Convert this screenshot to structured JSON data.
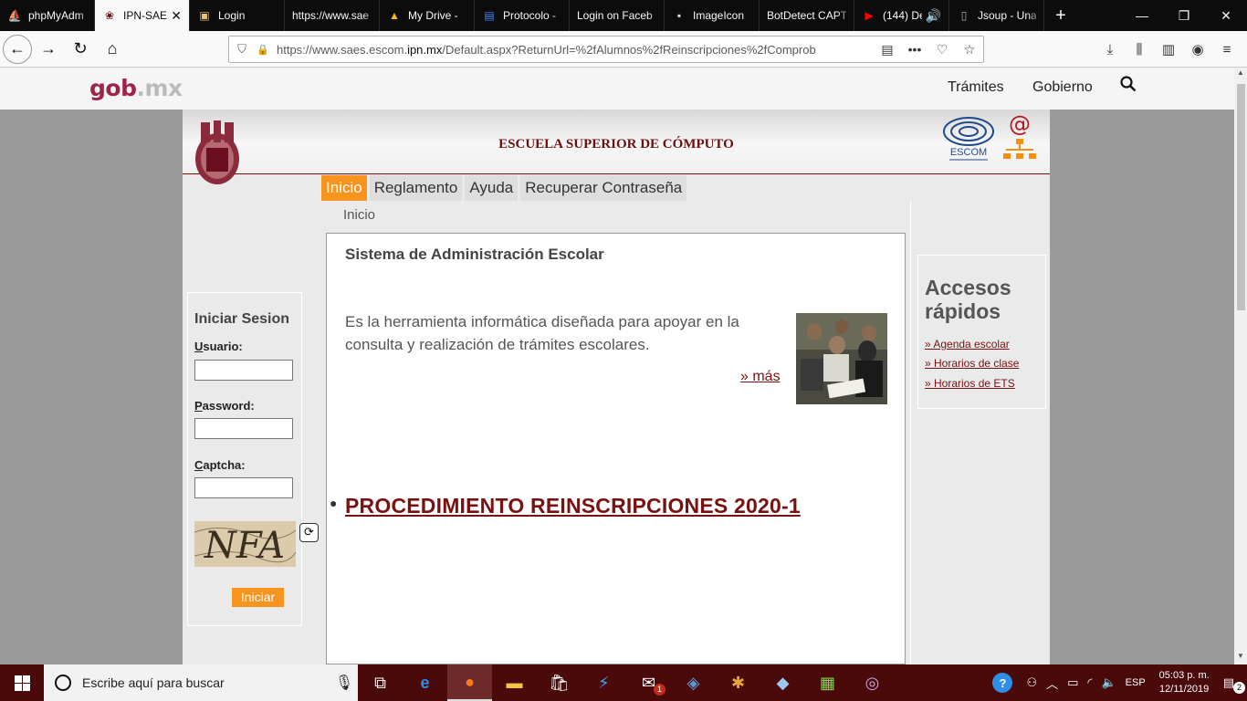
{
  "browser": {
    "tabs": [
      {
        "label": "phpMyAdm",
        "icon": "phpmyadmin-icon",
        "active": false
      },
      {
        "label": "IPN-SAE",
        "icon": "ipn-icon",
        "active": true
      },
      {
        "label": "Login",
        "icon": "image-icon",
        "active": false
      },
      {
        "label": "https://www.sae",
        "icon": "",
        "active": false
      },
      {
        "label": "My Drive - ",
        "icon": "google-drive-icon",
        "active": false
      },
      {
        "label": "Protocolo - ",
        "icon": "google-docs-icon",
        "active": false
      },
      {
        "label": "Login on Faceb",
        "icon": "",
        "active": false
      },
      {
        "label": "ImageIcon ",
        "icon": "page-icon",
        "active": false
      },
      {
        "label": "BotDetect CAPT",
        "icon": "",
        "active": false
      },
      {
        "label": "(144) De",
        "icon": "youtube-icon",
        "active": false
      },
      {
        "label": "Jsoup - Una",
        "icon": "page-icon",
        "active": false
      }
    ],
    "url_prefix": "https://www.saes.escom.",
    "url_domain": "ipn.mx",
    "url_rest": "/Default.aspx?ReturnUrl=%2fAlumnos%2fReinscripciones%2fComprob",
    "more_menu": "•••"
  },
  "gob": {
    "logo_main": "gob",
    "logo_suffix": ".mx",
    "nav_tramites": "Trámites",
    "nav_gobierno": "Gobierno"
  },
  "site": {
    "school_name": "ESCUELA SUPERIOR DE CÓMPUTO",
    "escom_label": "ESCOM",
    "menu": [
      "Inicio",
      "Reglamento",
      "Ayuda",
      "Recuperar Contraseña"
    ],
    "breadcrumb": "Inicio"
  },
  "login": {
    "title": "Iniciar Sesion",
    "usuario_key": "U",
    "usuario_rest": "suario:",
    "password_key": "P",
    "password_rest": "assword:",
    "captcha_key": "C",
    "captcha_rest": "aptcha:",
    "captcha_text": "NFA",
    "submit": "Iniciar"
  },
  "main": {
    "title": "Sistema de Administración Escolar",
    "description": "Es la herramienta informática diseñada para apoyar en la consulta y realización de trámites escolares.",
    "more_link": "» más",
    "procedure_link": "PROCEDIMIENTO REINSCRIPCIONES 2020-1"
  },
  "accesos": {
    "title": "Accesos rápidos",
    "links": [
      "» Agenda escolar",
      "» Horarios de clase",
      "» Horarios de ETS"
    ]
  },
  "taskbar": {
    "search_placeholder": "Escribe aquí para buscar",
    "language": "ESP",
    "time": "05:03 p. m.",
    "date": "12/11/2019",
    "notifications": "2",
    "mail_badge": "1"
  },
  "colors": {
    "brand_maroon": "#7a1010",
    "accent_orange": "#f7941d",
    "gob_red": "#9d2449"
  }
}
